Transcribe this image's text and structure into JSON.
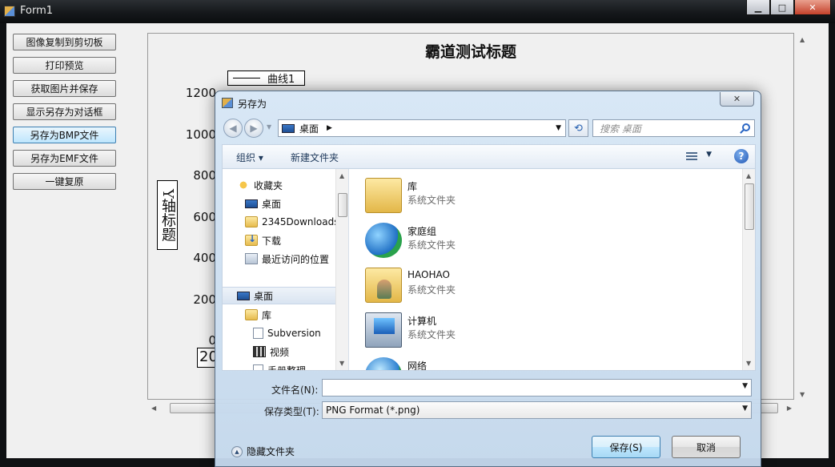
{
  "window": {
    "title": "Form1",
    "controls": {
      "minimize": "▁",
      "maximize": "□",
      "close": "✕"
    }
  },
  "sidebar": {
    "buttons": [
      "图像复制到剪切板",
      "打印预览",
      "获取图片并保存",
      "显示另存为对话框",
      "另存为BMP文件",
      "另存为EMF文件",
      "一键复原"
    ]
  },
  "chart_data": {
    "type": "line",
    "title": "霸道测试标题",
    "ylabel": "Y轴标题",
    "series": [
      {
        "name": "曲线1",
        "values": []
      }
    ],
    "y_ticks": [
      "1200",
      "1000",
      "800",
      "600",
      "400",
      "200",
      "0"
    ],
    "ylim": [
      0,
      1200
    ],
    "x_tick_partial": "20",
    "legend_position": "top-left"
  },
  "dialog": {
    "title": "另存为",
    "close_glyph": "✕",
    "address": "桌面",
    "search_placeholder": "搜索 桌面",
    "toolbar": {
      "organize": "组织 ▾",
      "new_folder": "新建文件夹",
      "help": "?"
    },
    "nav": {
      "favorites": "收藏夹",
      "desktop": "桌面",
      "downloads_2345": "2345Downloads",
      "downloads": "下载",
      "recent": "最近访问的位置",
      "desktop_root": "桌面",
      "libraries": "库",
      "subversion": "Subversion",
      "videos": "视频",
      "manual": "手册整理"
    },
    "items": [
      {
        "name": "库",
        "desc": "系统文件夹",
        "icon": "library-folder-icon"
      },
      {
        "name": "家庭组",
        "desc": "系统文件夹",
        "icon": "homegroup-icon"
      },
      {
        "name": "HAOHAO",
        "desc": "系统文件夹",
        "icon": "user-folder-icon"
      },
      {
        "name": "计算机",
        "desc": "系统文件夹",
        "icon": "computer-icon"
      },
      {
        "name": "网络",
        "desc": "",
        "icon": "network-icon"
      }
    ],
    "filename_label": "文件名(N):",
    "filename_value": "",
    "filetype_label": "保存类型(T):",
    "filetype_value": "PNG Format (*.png)",
    "hide_folders": "隐藏文件夹",
    "save": "保存(S)",
    "cancel": "取消"
  }
}
